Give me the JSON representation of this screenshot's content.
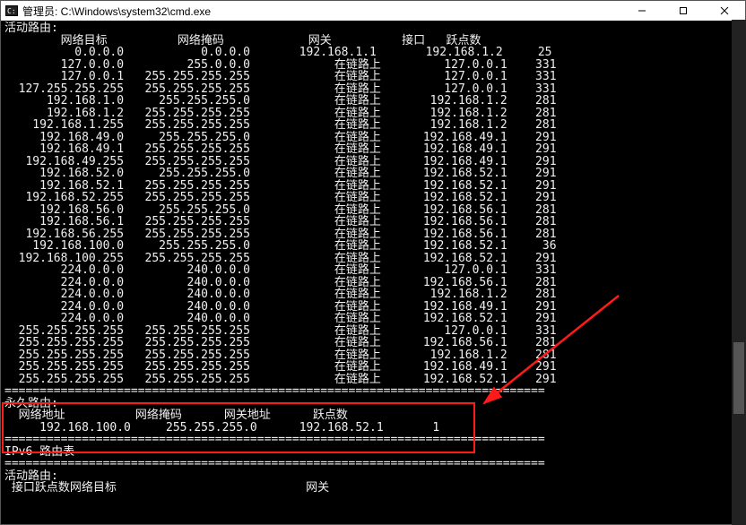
{
  "window": {
    "title": "管理员: C:\\Windows\\system32\\cmd.exe"
  },
  "headers": {
    "active_routes": "活动路由:",
    "col_dest": "网络目标",
    "col_mask": "网络掩码",
    "col_gateway": "网关",
    "col_interface": "接口",
    "col_metric": "跃点数",
    "persistent_routes": "永久路由:",
    "col_netaddr": "网络地址",
    "col_gw_addr": "网关地址",
    "ipv6_table": "IPv6 路由表",
    "iface_metric_dest": "接口跃点数网络目标"
  },
  "onlink": "在链路上",
  "sep": "=",
  "routes": [
    {
      "dest": "0.0.0.0",
      "mask": "0.0.0.0",
      "gw": "192.168.1.1",
      "iface": "192.168.1.2",
      "metric": "25"
    },
    {
      "dest": "127.0.0.0",
      "mask": "255.0.0.0",
      "gw": "@onlink",
      "iface": "127.0.0.1",
      "metric": "331"
    },
    {
      "dest": "127.0.0.1",
      "mask": "255.255.255.255",
      "gw": "@onlink",
      "iface": "127.0.0.1",
      "metric": "331"
    },
    {
      "dest": "127.255.255.255",
      "mask": "255.255.255.255",
      "gw": "@onlink",
      "iface": "127.0.0.1",
      "metric": "331"
    },
    {
      "dest": "192.168.1.0",
      "mask": "255.255.255.0",
      "gw": "@onlink",
      "iface": "192.168.1.2",
      "metric": "281"
    },
    {
      "dest": "192.168.1.2",
      "mask": "255.255.255.255",
      "gw": "@onlink",
      "iface": "192.168.1.2",
      "metric": "281"
    },
    {
      "dest": "192.168.1.255",
      "mask": "255.255.255.255",
      "gw": "@onlink",
      "iface": "192.168.1.2",
      "metric": "281"
    },
    {
      "dest": "192.168.49.0",
      "mask": "255.255.255.0",
      "gw": "@onlink",
      "iface": "192.168.49.1",
      "metric": "291"
    },
    {
      "dest": "192.168.49.1",
      "mask": "255.255.255.255",
      "gw": "@onlink",
      "iface": "192.168.49.1",
      "metric": "291"
    },
    {
      "dest": "192.168.49.255",
      "mask": "255.255.255.255",
      "gw": "@onlink",
      "iface": "192.168.49.1",
      "metric": "291"
    },
    {
      "dest": "192.168.52.0",
      "mask": "255.255.255.0",
      "gw": "@onlink",
      "iface": "192.168.52.1",
      "metric": "291"
    },
    {
      "dest": "192.168.52.1",
      "mask": "255.255.255.255",
      "gw": "@onlink",
      "iface": "192.168.52.1",
      "metric": "291"
    },
    {
      "dest": "192.168.52.255",
      "mask": "255.255.255.255",
      "gw": "@onlink",
      "iface": "192.168.52.1",
      "metric": "291"
    },
    {
      "dest": "192.168.56.0",
      "mask": "255.255.255.0",
      "gw": "@onlink",
      "iface": "192.168.56.1",
      "metric": "281"
    },
    {
      "dest": "192.168.56.1",
      "mask": "255.255.255.255",
      "gw": "@onlink",
      "iface": "192.168.56.1",
      "metric": "281"
    },
    {
      "dest": "192.168.56.255",
      "mask": "255.255.255.255",
      "gw": "@onlink",
      "iface": "192.168.56.1",
      "metric": "281"
    },
    {
      "dest": "192.168.100.0",
      "mask": "255.255.255.0",
      "gw": "@onlink",
      "iface": "192.168.52.1",
      "metric": "36"
    },
    {
      "dest": "192.168.100.255",
      "mask": "255.255.255.255",
      "gw": "@onlink",
      "iface": "192.168.52.1",
      "metric": "291"
    },
    {
      "dest": "224.0.0.0",
      "mask": "240.0.0.0",
      "gw": "@onlink",
      "iface": "127.0.0.1",
      "metric": "331"
    },
    {
      "dest": "224.0.0.0",
      "mask": "240.0.0.0",
      "gw": "@onlink",
      "iface": "192.168.56.1",
      "metric": "281"
    },
    {
      "dest": "224.0.0.0",
      "mask": "240.0.0.0",
      "gw": "@onlink",
      "iface": "192.168.1.2",
      "metric": "281"
    },
    {
      "dest": "224.0.0.0",
      "mask": "240.0.0.0",
      "gw": "@onlink",
      "iface": "192.168.49.1",
      "metric": "291"
    },
    {
      "dest": "224.0.0.0",
      "mask": "240.0.0.0",
      "gw": "@onlink",
      "iface": "192.168.52.1",
      "metric": "291"
    },
    {
      "dest": "255.255.255.255",
      "mask": "255.255.255.255",
      "gw": "@onlink",
      "iface": "127.0.0.1",
      "metric": "331"
    },
    {
      "dest": "255.255.255.255",
      "mask": "255.255.255.255",
      "gw": "@onlink",
      "iface": "192.168.56.1",
      "metric": "281"
    },
    {
      "dest": "255.255.255.255",
      "mask": "255.255.255.255",
      "gw": "@onlink",
      "iface": "192.168.1.2",
      "metric": "281"
    },
    {
      "dest": "255.255.255.255",
      "mask": "255.255.255.255",
      "gw": "@onlink",
      "iface": "192.168.49.1",
      "metric": "291"
    },
    {
      "dest": "255.255.255.255",
      "mask": "255.255.255.255",
      "gw": "@onlink",
      "iface": "192.168.52.1",
      "metric": "291"
    }
  ],
  "persistent": [
    {
      "addr": "192.168.100.0",
      "mask": "255.255.255.0",
      "gw": "192.168.52.1",
      "metric": "1"
    }
  ]
}
